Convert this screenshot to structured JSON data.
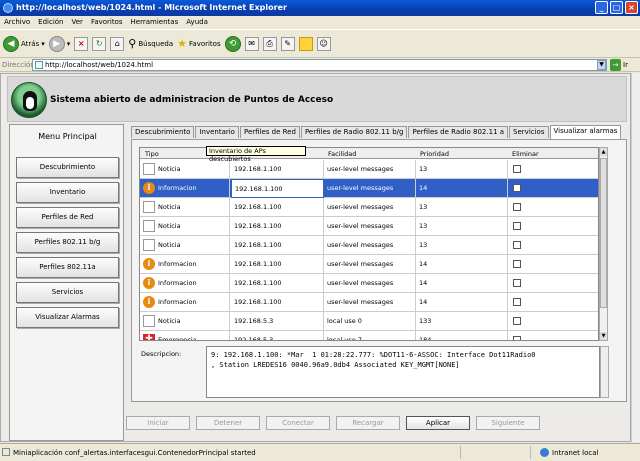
{
  "window": {
    "title": "http://localhost/web/1024.html - Microsoft Internet Explorer"
  },
  "menu": [
    "Archivo",
    "Edición",
    "Ver",
    "Favoritos",
    "Herramientas",
    "Ayuda"
  ],
  "toolbar": {
    "back_label": "Atrás",
    "search_label": "Búsqueda",
    "favorites_label": "Favoritos"
  },
  "address": {
    "label": "Dirección",
    "url": "http://localhost/web/1024.html",
    "go_label": "Ir"
  },
  "app": {
    "title": "Sistema abierto de administracion de Puntos de Acceso",
    "menu_title": "Menu Principal",
    "nav": [
      "Descubrimiento",
      "Inventario",
      "Perfiles de Red",
      "Perfiles 802.11 b/g",
      "Perfiles 802.11a",
      "Servicios",
      "Visualizar Alarmas"
    ]
  },
  "tabs": [
    "Descubrimiento",
    "Inventario",
    "Perfiles de Red",
    "Perfiles de Radio 802.11 b/g",
    "Perfiles de Radio 802.11 a",
    "Servicios",
    "Visualizar alarmas"
  ],
  "active_tab": "Visualizar alarmas",
  "tooltip": "Inventario de APs descubiertos",
  "table": {
    "columns": [
      "Tipo",
      "",
      "Facilidad",
      "Prioridad",
      "Eliminar"
    ],
    "rows": [
      {
        "tipo": "Noticia",
        "icon": "document-icon",
        "ip": "192.168.1.100",
        "facilidad": "user-level messages",
        "prioridad": "13",
        "selected": false
      },
      {
        "tipo": "Informacion",
        "icon": "info-icon",
        "ip": "192.168.1.100",
        "facilidad": "user-level messages",
        "prioridad": "14",
        "selected": true
      },
      {
        "tipo": "Noticia",
        "icon": "document-icon",
        "ip": "192.168.1.100",
        "facilidad": "user-level messages",
        "prioridad": "13",
        "selected": false
      },
      {
        "tipo": "Noticia",
        "icon": "document-icon",
        "ip": "192.168.1.100",
        "facilidad": "user-level messages",
        "prioridad": "13",
        "selected": false
      },
      {
        "tipo": "Noticia",
        "icon": "document-icon",
        "ip": "192.168.1.100",
        "facilidad": "user-level messages",
        "prioridad": "13",
        "selected": false
      },
      {
        "tipo": "Informacion",
        "icon": "info-icon",
        "ip": "192.168.1.100",
        "facilidad": "user-level messages",
        "prioridad": "14",
        "selected": false
      },
      {
        "tipo": "Informacion",
        "icon": "info-icon",
        "ip": "192.168.1.100",
        "facilidad": "user-level messages",
        "prioridad": "14",
        "selected": false
      },
      {
        "tipo": "Informacion",
        "icon": "info-icon",
        "ip": "192.168.1.100",
        "facilidad": "user-level messages",
        "prioridad": "14",
        "selected": false
      },
      {
        "tipo": "Noticia",
        "icon": "document-icon",
        "ip": "192.168.5.3",
        "facilidad": "local use 0",
        "prioridad": "133",
        "selected": false
      },
      {
        "tipo": "Emergencia",
        "icon": "error-icon",
        "ip": "192.168.5.3",
        "facilidad": "local use 7",
        "prioridad": "184",
        "selected": false
      }
    ]
  },
  "description": {
    "label": "Descripcion:",
    "text": "9: 192.168.1.100: *Mar  1 01:28:22.777: %DOT11-6-ASSOC: Interface Dot11Radio0\n, Station LREDES16 0040.96a9.0db4 Associated KEY_MGMT[NONE]"
  },
  "buttons": [
    {
      "label": "Iniciar",
      "enabled": false
    },
    {
      "label": "Detener",
      "enabled": false
    },
    {
      "label": "Conectar",
      "enabled": false
    },
    {
      "label": "Recargar",
      "enabled": false
    },
    {
      "label": "Aplicar",
      "enabled": true
    },
    {
      "label": "Siguiente",
      "enabled": false
    }
  ],
  "status": {
    "text": "Miniaplicación conf_alertas.interfacesgui.ContenedorPrincipal started",
    "zone": "Intranet local"
  }
}
